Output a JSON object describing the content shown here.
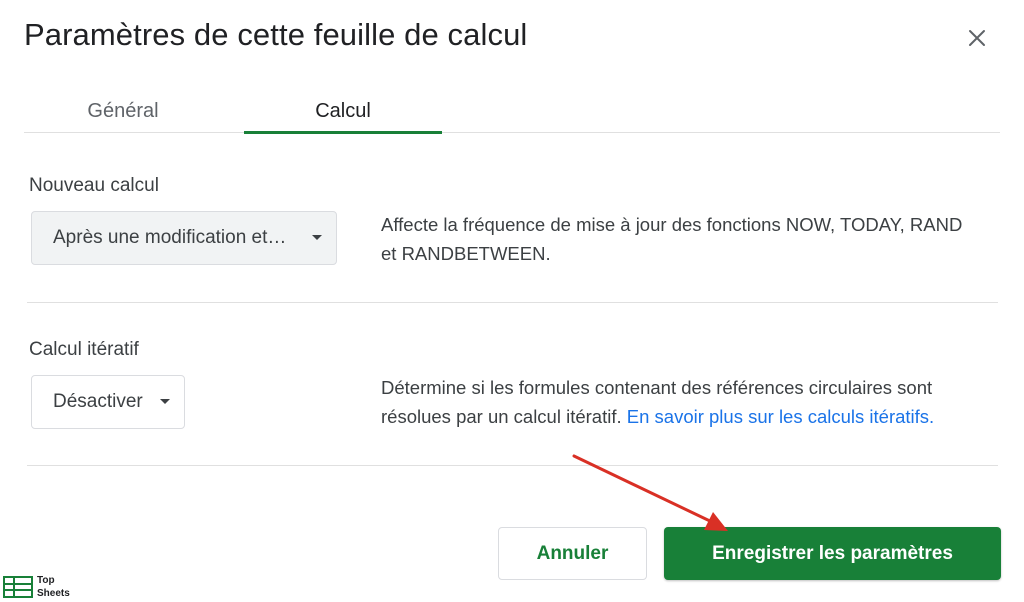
{
  "dialog": {
    "title": "Paramètres de cette feuille de calcul",
    "close_icon": "close-icon"
  },
  "tabs": [
    {
      "label": "Général",
      "active": false
    },
    {
      "label": "Calcul",
      "active": true
    }
  ],
  "recalculation": {
    "label": "Nouveau calcul",
    "selected": "Après une modification et…",
    "description": "Affecte la fréquence de mise à jour des fonctions NOW, TODAY, RAND et RANDBETWEEN."
  },
  "iterative": {
    "label": "Calcul itératif",
    "selected": "Désactiver",
    "description": "Détermine si les formules contenant des références circulaires sont résolues par un calcul itératif.",
    "link": "En savoir plus sur les calculs itératifs."
  },
  "buttons": {
    "cancel": "Annuler",
    "save": "Enregistrer les paramètres"
  },
  "watermark": {
    "line1": "Top",
    "line2": "Sheets"
  },
  "colors": {
    "accent_green": "#188038",
    "link_blue": "#1a73e8",
    "annotation_red": "#d93025"
  }
}
